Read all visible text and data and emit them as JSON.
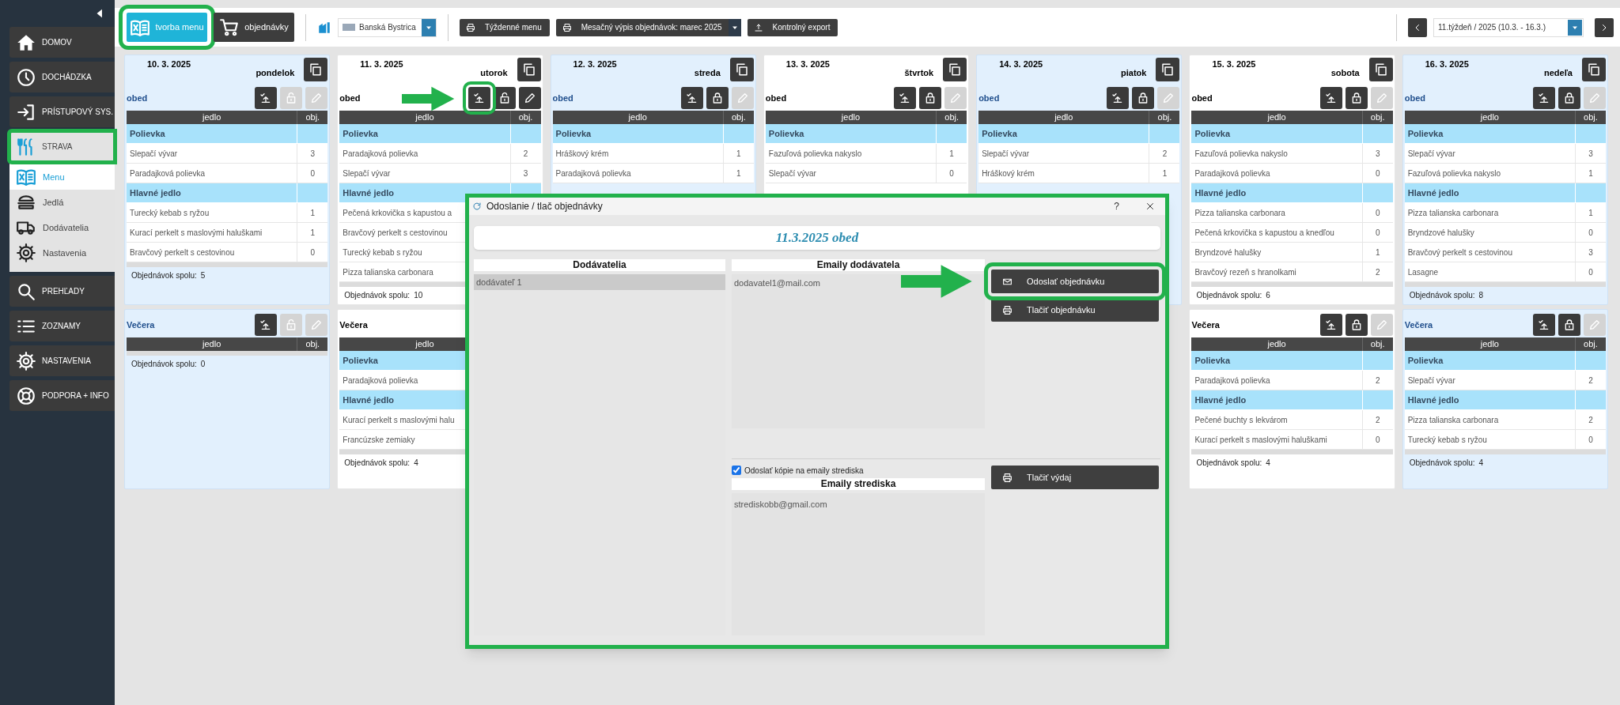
{
  "sidebar": {
    "items": [
      {
        "label": "DOMOV",
        "selected": false
      },
      {
        "label": "DOCHÁDZKA",
        "selected": false
      },
      {
        "label": "PRÍSTUPOVÝ SYS.",
        "selected": false
      },
      {
        "label": "STRAVA",
        "selected": true,
        "callout": true,
        "children": [
          {
            "label": "Menu",
            "selected": true
          },
          {
            "label": "Jedlá",
            "selected": false
          },
          {
            "label": "Dodávatelia",
            "selected": false
          },
          {
            "label": "Nastavenia",
            "selected": false
          }
        ]
      },
      {
        "label": "PREHĽADY",
        "selected": false
      },
      {
        "label": "ZOZNAMY",
        "selected": false
      },
      {
        "label": "NASTAVENIA",
        "selected": false
      },
      {
        "label": "PODPORA + INFO",
        "selected": false
      }
    ]
  },
  "toolbar": {
    "tabs": [
      {
        "label": "tvorba menu",
        "selected": true,
        "callout": true
      },
      {
        "label": "objednávky",
        "selected": false
      }
    ],
    "location": "Banská Bystrica",
    "buttons": [
      {
        "label": "Týždenné menu",
        "kind": "print"
      },
      {
        "label": "Mesačný výpis objednávok: marec 2025",
        "kind": "print_dropdown"
      },
      {
        "label": "Kontrolný export",
        "kind": "export"
      }
    ],
    "week": "11.týždeň / 2025 (10.3. - 16.3.)"
  },
  "days": [
    {
      "date": "10. 3. 2025",
      "weekday": "pondelok",
      "highlighted": true,
      "meals": [
        {
          "title": "obed",
          "columns": [
            "jedlo",
            "obj."
          ],
          "buttons": [
            {
              "kind": "send",
              "enabled": true
            },
            {
              "kind": "unlock",
              "enabled": false
            },
            {
              "kind": "edit",
              "enabled": false
            }
          ],
          "rows": [
            {
              "kind": "category",
              "label": "Polievka"
            },
            {
              "kind": "dish",
              "label": "Slepačí vývar",
              "count": "3"
            },
            {
              "kind": "dish",
              "label": "Paradajková polievka",
              "count": "0"
            },
            {
              "kind": "category",
              "label": "Hlavné jedlo"
            },
            {
              "kind": "dish",
              "label": "Turecký kebab s ryžou",
              "count": "1"
            },
            {
              "kind": "dish",
              "label": "Kurací perkelt s maslovými haluškami",
              "count": "1"
            },
            {
              "kind": "dish",
              "label": "Bravčový perkelt s cestovinou",
              "count": "0"
            }
          ],
          "total_label": "Objednávok spolu:",
          "total": "5"
        },
        {
          "title": "Večera",
          "columns": [
            "jedlo",
            "obj."
          ],
          "buttons": [
            {
              "kind": "send",
              "enabled": true
            },
            {
              "kind": "unlock",
              "enabled": false
            },
            {
              "kind": "edit",
              "enabled": false
            }
          ],
          "total_label": "Objednávok spolu:",
          "total": "0"
        }
      ]
    },
    {
      "date": "11. 3. 2025",
      "weekday": "utorok",
      "highlighted": false,
      "meals": [
        {
          "title": "obed",
          "columns": [
            "jedlo",
            "obj."
          ],
          "buttons": [
            {
              "kind": "send",
              "enabled": true,
              "callout": true
            },
            {
              "kind": "unlock",
              "enabled": true
            },
            {
              "kind": "edit",
              "enabled": true
            }
          ],
          "rows": [
            {
              "kind": "category",
              "label": "Polievka"
            },
            {
              "kind": "dish",
              "label": "Paradajková polievka",
              "count": "2"
            },
            {
              "kind": "dish",
              "label": "Slepačí vývar",
              "count": "3"
            },
            {
              "kind": "category",
              "label": "Hlavné jedlo"
            },
            {
              "kind": "dish",
              "label": "Pečená krkovička s kapustou a"
            },
            {
              "kind": "dish",
              "label": "Bravčový perkelt s cestovinou"
            },
            {
              "kind": "dish",
              "label": "Turecký kebab s ryžou"
            },
            {
              "kind": "dish",
              "label": "Pizza talianska carbonara"
            }
          ],
          "total_label": "Objednávok spolu:",
          "total": "10"
        },
        {
          "title": "Večera",
          "columns": [
            "jedlo"
          ],
          "rows": [
            {
              "kind": "category",
              "label": "Polievka"
            },
            {
              "kind": "dish",
              "label": "Paradajková polievka"
            },
            {
              "kind": "category",
              "label": "Hlavné jedlo"
            },
            {
              "kind": "dish",
              "label": "Kurací perkelt s maslovými halu"
            },
            {
              "kind": "dish",
              "label": "Francúzske zemiaky"
            }
          ],
          "total_label": "Objednávok spolu:",
          "total": "4"
        }
      ]
    },
    {
      "date": "12. 3. 2025",
      "weekday": "streda",
      "highlighted": true,
      "meals": [
        {
          "title": "obed",
          "columns": [
            "jedlo",
            "obj."
          ],
          "buttons": [
            {
              "kind": "send",
              "enabled": true
            },
            {
              "kind": "lock",
              "enabled": true
            },
            {
              "kind": "edit",
              "enabled": false
            }
          ],
          "rows": [
            {
              "kind": "category",
              "label": "Polievka"
            },
            {
              "kind": "dish",
              "label": "Hráškový krém",
              "count": "1"
            },
            {
              "kind": "dish",
              "label": "Paradajková polievka",
              "count": "1"
            }
          ]
        }
      ]
    },
    {
      "date": "13. 3. 2025",
      "weekday": "štvrtok",
      "highlighted": false,
      "meals": [
        {
          "title": "obed",
          "columns": [
            "jedlo",
            "obj."
          ],
          "buttons": [
            {
              "kind": "send",
              "enabled": true
            },
            {
              "kind": "lock",
              "enabled": true
            },
            {
              "kind": "edit",
              "enabled": false
            }
          ],
          "rows": [
            {
              "kind": "category",
              "label": "Polievka"
            },
            {
              "kind": "dish",
              "label": "Fazuľová polievka nakyslo",
              "count": "1"
            },
            {
              "kind": "dish",
              "label": "Slepačí vývar",
              "count": "0"
            }
          ]
        }
      ]
    },
    {
      "date": "14. 3. 2025",
      "weekday": "piatok",
      "highlighted": true,
      "meals": [
        {
          "title": "obed",
          "columns": [
            "jedlo",
            "obj."
          ],
          "buttons": [
            {
              "kind": "send",
              "enabled": true
            },
            {
              "kind": "lock",
              "enabled": true
            },
            {
              "kind": "edit",
              "enabled": false
            }
          ],
          "rows": [
            {
              "kind": "category",
              "label": "Polievka"
            },
            {
              "kind": "dish",
              "label": "Slepačí vývar",
              "count": "2"
            },
            {
              "kind": "dish",
              "label": "Hráškový krém",
              "count": "1"
            }
          ]
        }
      ]
    },
    {
      "date": "15. 3. 2025",
      "weekday": "sobota",
      "highlighted": false,
      "meals": [
        {
          "title": "obed",
          "columns": [
            "jedlo",
            "obj."
          ],
          "buttons": [
            {
              "kind": "send",
              "enabled": true
            },
            {
              "kind": "lock",
              "enabled": true
            },
            {
              "kind": "edit",
              "enabled": false
            }
          ],
          "rows": [
            {
              "kind": "category",
              "label": "Polievka"
            },
            {
              "kind": "dish",
              "label": "Fazuľová polievka nakyslo",
              "count": "3"
            },
            {
              "kind": "dish",
              "label": "Paradajková polievka",
              "count": "0"
            },
            {
              "kind": "category",
              "label": "Hlavné jedlo"
            },
            {
              "kind": "dish",
              "label": "Pizza talianska carbonara",
              "count": "0"
            },
            {
              "kind": "dish",
              "label": "Pečená krkovička s kapustou a knedľou",
              "count": "0"
            },
            {
              "kind": "dish",
              "label": "Bryndzové halušky",
              "count": "1"
            },
            {
              "kind": "dish",
              "label": "Bravčový rezeň s hranolkami",
              "count": "2"
            }
          ],
          "total_label": "Objednávok spolu:",
          "total": "6"
        },
        {
          "title": "Večera",
          "columns": [
            "jedlo",
            "obj."
          ],
          "buttons": [
            {
              "kind": "send",
              "enabled": true
            },
            {
              "kind": "lock",
              "enabled": true
            },
            {
              "kind": "edit",
              "enabled": false
            }
          ],
          "rows": [
            {
              "kind": "category",
              "label": "Polievka"
            },
            {
              "kind": "dish",
              "label": "Paradajková polievka",
              "count": "2"
            },
            {
              "kind": "category",
              "label": "Hlavné jedlo"
            },
            {
              "kind": "dish",
              "label": "Pečené buchty s lekvárom",
              "count": "2"
            },
            {
              "kind": "dish",
              "label": "Kurací perkelt s maslovými haluškami",
              "count": "0"
            }
          ],
          "total_label": "Objednávok spolu:",
          "total": "4"
        }
      ]
    },
    {
      "date": "16. 3. 2025",
      "weekday": "nedeľa",
      "highlighted": true,
      "meals": [
        {
          "title": "obed",
          "columns": [
            "jedlo",
            "obj."
          ],
          "buttons": [
            {
              "kind": "send",
              "enabled": true
            },
            {
              "kind": "lock",
              "enabled": true
            },
            {
              "kind": "edit",
              "enabled": false
            }
          ],
          "rows": [
            {
              "kind": "category",
              "label": "Polievka"
            },
            {
              "kind": "dish",
              "label": "Slepačí vývar",
              "count": "3"
            },
            {
              "kind": "dish",
              "label": "Fazuľová polievka nakyslo",
              "count": "1"
            },
            {
              "kind": "category",
              "label": "Hlavné jedlo"
            },
            {
              "kind": "dish",
              "label": "Pizza talianska carbonara",
              "count": "1"
            },
            {
              "kind": "dish",
              "label": "Bryndzové halušky",
              "count": "0"
            },
            {
              "kind": "dish",
              "label": "Bravčový perkelt s cestovinou",
              "count": "3"
            },
            {
              "kind": "dish",
              "label": "Lasagne",
              "count": "0"
            }
          ],
          "total_label": "Objednávok spolu:",
          "total": "8"
        },
        {
          "title": "Večera",
          "columns": [
            "jedlo",
            "obj."
          ],
          "buttons": [
            {
              "kind": "send",
              "enabled": true
            },
            {
              "kind": "lock",
              "enabled": true
            },
            {
              "kind": "edit",
              "enabled": false
            }
          ],
          "rows": [
            {
              "kind": "category",
              "label": "Polievka"
            },
            {
              "kind": "dish",
              "label": "Slepačí vývar",
              "count": "2"
            },
            {
              "kind": "category",
              "label": "Hlavné jedlo"
            },
            {
              "kind": "dish",
              "label": "Pizza talianska carbonara",
              "count": "2"
            },
            {
              "kind": "dish",
              "label": "Turecký kebab s ryžou",
              "count": "0"
            }
          ],
          "total_label": "Objednávok spolu:",
          "total": "4"
        }
      ]
    }
  ],
  "dialog": {
    "title": "Odoslanie / tlač objednávky",
    "help": "?",
    "callout": true,
    "heading": "11.3.2025 obed",
    "suppliers": {
      "header": "Dodávatelia",
      "items": [
        {
          "label": "dodávateľ 1",
          "selected": true
        }
      ]
    },
    "supplier_emails": {
      "header": "Emaily dodávatela",
      "items": [
        "dodavatel1@mail.com"
      ]
    },
    "actions": [
      {
        "label": "Odoslať objednávku",
        "kind": "mail",
        "callout": true
      },
      {
        "label": "Tlačiť objednávku",
        "kind": "print"
      }
    ],
    "copy_checkbox": {
      "label": "Odoslať kópie na emaily strediska",
      "checked": true
    },
    "center_emails": {
      "header": "Emaily strediska",
      "items": [
        "strediskobb@gmail.com"
      ]
    },
    "lower_actions": [
      {
        "label": "Tlačiť výdaj",
        "kind": "print"
      }
    ]
  }
}
